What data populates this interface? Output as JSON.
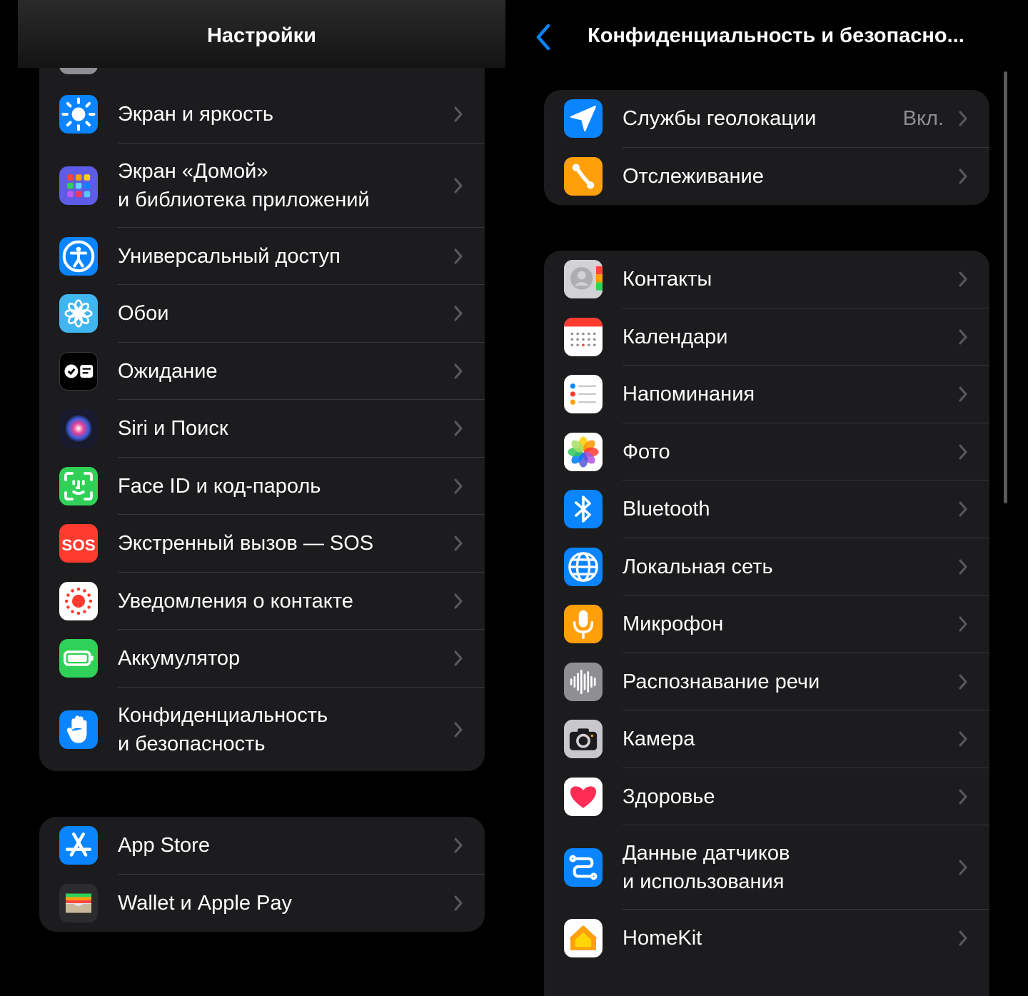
{
  "left": {
    "title": "Настройки",
    "group1": [
      {
        "label": "Экран и яркость",
        "icon": "sun-icon",
        "bg": "#0a84ff"
      },
      {
        "label": "Экран «Домой»\nи библиотека приложений",
        "icon": "home-grid-icon",
        "bg": "#5e5ce6"
      },
      {
        "label": "Универсальный доступ",
        "icon": "accessibility-icon",
        "bg": "#0a84ff"
      },
      {
        "label": "Обои",
        "icon": "flower-icon",
        "bg": "#40b6f0"
      },
      {
        "label": "Ожидание",
        "icon": "standby-icon",
        "bg": "#000000"
      },
      {
        "label": "Siri и Поиск",
        "icon": "siri-icon",
        "bg": "#1a1a2e"
      },
      {
        "label": "Face ID и код-пароль",
        "icon": "face-id-icon",
        "bg": "#30d158"
      },
      {
        "label": "Экстренный вызов — SOS",
        "icon": "sos-icon",
        "bg": "#ff3b30"
      },
      {
        "label": "Уведомления о контакте",
        "icon": "exposure-icon",
        "bg": "#ffffff"
      },
      {
        "label": "Аккумулятор",
        "icon": "battery-icon",
        "bg": "#30d158"
      },
      {
        "label": "Конфиденциальность\nи безопасность",
        "icon": "hand-icon",
        "bg": "#0a84ff"
      }
    ],
    "group2": [
      {
        "label": "App Store",
        "icon": "app-store-icon",
        "bg": "#0a84ff"
      },
      {
        "label": "Wallet и Apple Pay",
        "icon": "wallet-icon",
        "bg": "#2c2c2e"
      }
    ]
  },
  "right": {
    "title": "Конфиденциальность и безопасно...",
    "group1": [
      {
        "label": "Службы геолокации",
        "value": "Вкл.",
        "icon": "location-arrow-icon",
        "bg": "#0a84ff"
      },
      {
        "label": "Отслеживание",
        "icon": "tracking-icon",
        "bg": "#ff9f0a"
      }
    ],
    "group2": [
      {
        "label": "Контакты",
        "icon": "contacts-icon",
        "bg": "#c7c7cc"
      },
      {
        "label": "Календари",
        "icon": "calendar-icon",
        "bg": "#ffffff"
      },
      {
        "label": "Напоминания",
        "icon": "reminders-icon",
        "bg": "#ffffff"
      },
      {
        "label": "Фото",
        "icon": "photos-icon",
        "bg": "#ffffff"
      },
      {
        "label": "Bluetooth",
        "icon": "bluetooth-icon",
        "bg": "#0a84ff"
      },
      {
        "label": "Локальная сеть",
        "icon": "globe-icon",
        "bg": "#0a84ff"
      },
      {
        "label": "Микрофон",
        "icon": "microphone-icon",
        "bg": "#ff9f0a"
      },
      {
        "label": "Распознавание речи",
        "icon": "waveform-icon",
        "bg": "#8e8e93"
      },
      {
        "label": "Камера",
        "icon": "camera-icon",
        "bg": "#8e8e93"
      },
      {
        "label": "Здоровье",
        "icon": "heart-icon",
        "bg": "#ffffff"
      },
      {
        "label": "Данные датчиков\nи использования",
        "icon": "sensor-data-icon",
        "bg": "#0a84ff"
      },
      {
        "label": "HomeKit",
        "icon": "homekit-icon",
        "bg": "#ffffff"
      }
    ]
  }
}
